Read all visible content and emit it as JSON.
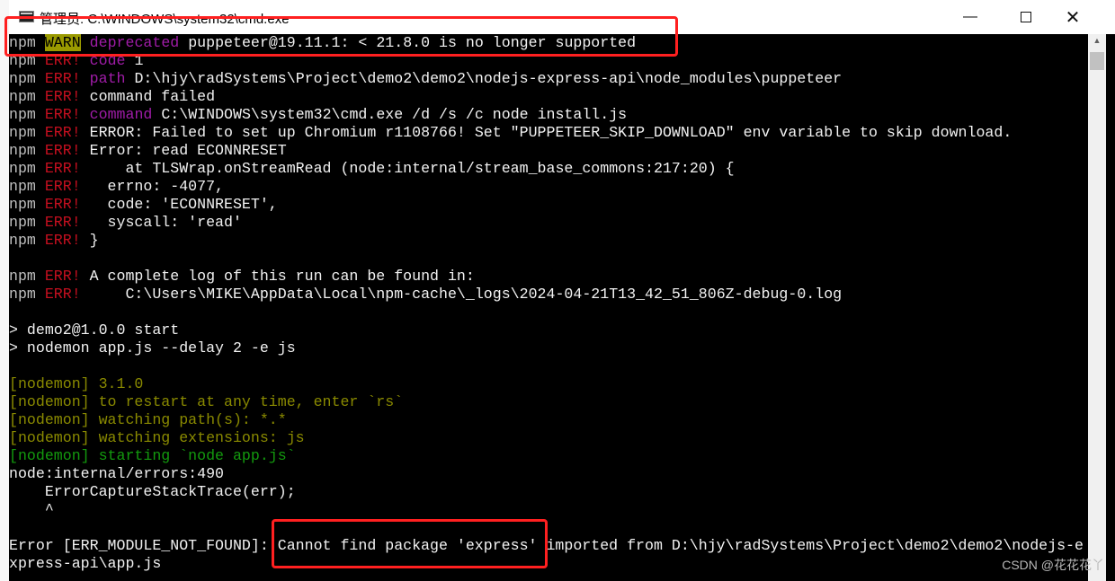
{
  "window": {
    "title": "管理员: C:\\WINDOWS\\system32\\cmd.exe",
    "minimize_icon": "minimize-icon",
    "maximize_icon": "maximize-icon",
    "close_icon": "close-icon"
  },
  "colors": {
    "default": "#c0c0c0",
    "white": "#f2f2f2",
    "red": "#c50f1f",
    "purple": "#a01ca8",
    "olive": "#8a8a00",
    "green": "#139a0e",
    "warn_bg": "#9a9a00",
    "annotation": "#ff2020"
  },
  "terminal": {
    "lines": [
      [
        [
          "npm ",
          "default"
        ],
        [
          "WARN",
          "warnbg"
        ],
        [
          " ",
          "default"
        ],
        [
          "deprecated",
          "purple"
        ],
        [
          " puppeteer@19.11.1: < 21.8.0 is no longer supported",
          "white"
        ]
      ],
      [
        [
          "npm ",
          "default"
        ],
        [
          "ERR!",
          "red"
        ],
        [
          " ",
          "default"
        ],
        [
          "code",
          "purple"
        ],
        [
          " 1",
          "white"
        ]
      ],
      [
        [
          "npm ",
          "default"
        ],
        [
          "ERR!",
          "red"
        ],
        [
          " ",
          "default"
        ],
        [
          "path",
          "purple"
        ],
        [
          " D:\\hjy\\radSystems\\Project\\demo2\\demo2\\nodejs-express-api\\node_modules\\puppeteer",
          "white"
        ]
      ],
      [
        [
          "npm ",
          "default"
        ],
        [
          "ERR!",
          "red"
        ],
        [
          " command failed",
          "white"
        ]
      ],
      [
        [
          "npm ",
          "default"
        ],
        [
          "ERR!",
          "red"
        ],
        [
          " ",
          "default"
        ],
        [
          "command",
          "purple"
        ],
        [
          " C:\\WINDOWS\\system32\\cmd.exe /d /s /c node install.js",
          "white"
        ]
      ],
      [
        [
          "npm ",
          "default"
        ],
        [
          "ERR!",
          "red"
        ],
        [
          " ERROR: Failed to set up Chromium r1108766! Set \"PUPPETEER_SKIP_DOWNLOAD\" env variable to skip download.",
          "white"
        ]
      ],
      [
        [
          "npm ",
          "default"
        ],
        [
          "ERR!",
          "red"
        ],
        [
          " Error: read ECONNRESET",
          "white"
        ]
      ],
      [
        [
          "npm ",
          "default"
        ],
        [
          "ERR!",
          "red"
        ],
        [
          "     at TLSWrap.onStreamRead (node:internal/stream_base_commons:217:20) {",
          "white"
        ]
      ],
      [
        [
          "npm ",
          "default"
        ],
        [
          "ERR!",
          "red"
        ],
        [
          "   errno: -4077,",
          "white"
        ]
      ],
      [
        [
          "npm ",
          "default"
        ],
        [
          "ERR!",
          "red"
        ],
        [
          "   code: 'ECONNRESET',",
          "white"
        ]
      ],
      [
        [
          "npm ",
          "default"
        ],
        [
          "ERR!",
          "red"
        ],
        [
          "   syscall: 'read'",
          "white"
        ]
      ],
      [
        [
          "npm ",
          "default"
        ],
        [
          "ERR!",
          "red"
        ],
        [
          " }",
          "white"
        ]
      ],
      [],
      [
        [
          "npm ",
          "default"
        ],
        [
          "ERR!",
          "red"
        ],
        [
          " A complete log of this run can be found in:",
          "white"
        ]
      ],
      [
        [
          "npm ",
          "default"
        ],
        [
          "ERR!",
          "red"
        ],
        [
          "     C:\\Users\\MIKE\\AppData\\Local\\npm-cache\\_logs\\2024-04-21T13_42_51_806Z-debug-0.log",
          "white"
        ]
      ],
      [],
      [
        [
          "> demo2@1.0.0 start",
          "white"
        ]
      ],
      [
        [
          "> nodemon app.js --delay 2 -e js",
          "white"
        ]
      ],
      [],
      [
        [
          "[nodemon] 3.1.0",
          "olive"
        ]
      ],
      [
        [
          "[nodemon] to restart at any time, enter `rs`",
          "olive"
        ]
      ],
      [
        [
          "[nodemon] watching path(s): *.*",
          "olive"
        ]
      ],
      [
        [
          "[nodemon] watching extensions: js",
          "olive"
        ]
      ],
      [
        [
          "[nodemon] starting `node app.js`",
          "green"
        ]
      ],
      [
        [
          "node:internal/errors:490",
          "white"
        ]
      ],
      [
        [
          "    ErrorCaptureStackTrace(err);",
          "white"
        ]
      ],
      [
        [
          "    ^",
          "white"
        ]
      ],
      [],
      [
        [
          "Error [ERR_MODULE_NOT_FOUND]: Cannot find package 'express' imported from D:\\hjy\\radSystems\\Project\\demo2\\demo2\\nodejs-e",
          "white"
        ]
      ],
      [
        [
          "xpress-api\\app.js",
          "white"
        ]
      ]
    ]
  },
  "watermark": "CSDN @花花花丫"
}
